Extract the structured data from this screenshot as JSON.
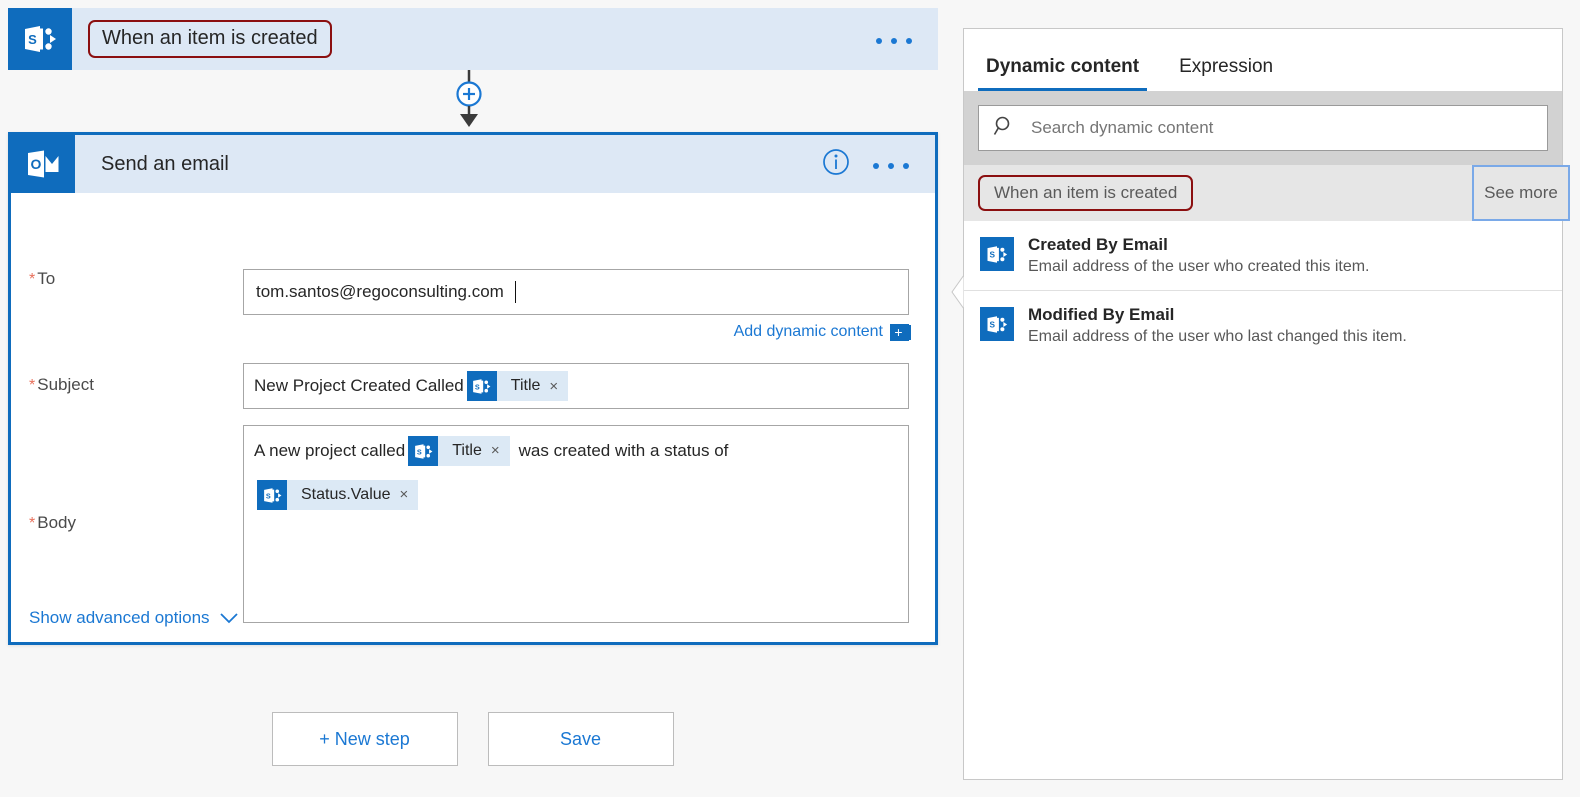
{
  "designer": {
    "trigger": {
      "icon": "sharepoint-icon",
      "title": "When an item is created",
      "menu_icon": "ellipsis-icon"
    },
    "connector": {
      "icon": "add-step-plus-icon"
    },
    "action": {
      "icon": "outlook-icon",
      "title": "Send an email",
      "info_icon": "info-icon",
      "menu_icon": "ellipsis-icon",
      "fields": {
        "to": {
          "required_mark": "*",
          "label": "To",
          "value": "tom.santos@regoconsulting.com"
        },
        "add_dynamic_content": {
          "label": "Add dynamic content",
          "plus": "+"
        },
        "subject": {
          "required_mark": "*",
          "label": "Subject",
          "text": "New Project Created Called",
          "token": {
            "icon": "sharepoint-icon",
            "label": "Title",
            "remove": "×"
          }
        },
        "body": {
          "required_mark": "*",
          "label": "Body",
          "text_before": "A new project called",
          "token1": {
            "icon": "sharepoint-icon",
            "label": "Title",
            "remove": "×"
          },
          "text_after": "was created with a status of",
          "token2": {
            "icon": "sharepoint-icon",
            "label": "Status.Value",
            "remove": "×"
          }
        }
      },
      "advanced_options": {
        "label": "Show advanced options",
        "chevron_icon": "chevron-down-icon"
      }
    },
    "buttons": {
      "new_step": "+ New step",
      "save": "Save"
    }
  },
  "dynamic_content_panel": {
    "tabs": [
      {
        "label": "Dynamic content",
        "active": true
      },
      {
        "label": "Expression",
        "active": false
      }
    ],
    "search": {
      "icon": "search-icon",
      "placeholder": "Search dynamic content",
      "value": ""
    },
    "group": {
      "title": "When an item is created",
      "see_more": "See more"
    },
    "items": [
      {
        "icon": "sharepoint-icon",
        "title": "Created By Email",
        "description": "Email address of the user who created this item."
      },
      {
        "icon": "sharepoint-icon",
        "title": "Modified By Email",
        "description": "Email address of the user who last changed this item."
      }
    ]
  },
  "colors": {
    "brand_blue": "#0f6cbd",
    "link_blue": "#1b78d3",
    "card_header_blue": "#dde8f5",
    "token_blue": "#dce9f5",
    "highlight_red": "#8b0f10",
    "required_red": "#e8705b",
    "panel_gray": "#d2d2d2"
  }
}
